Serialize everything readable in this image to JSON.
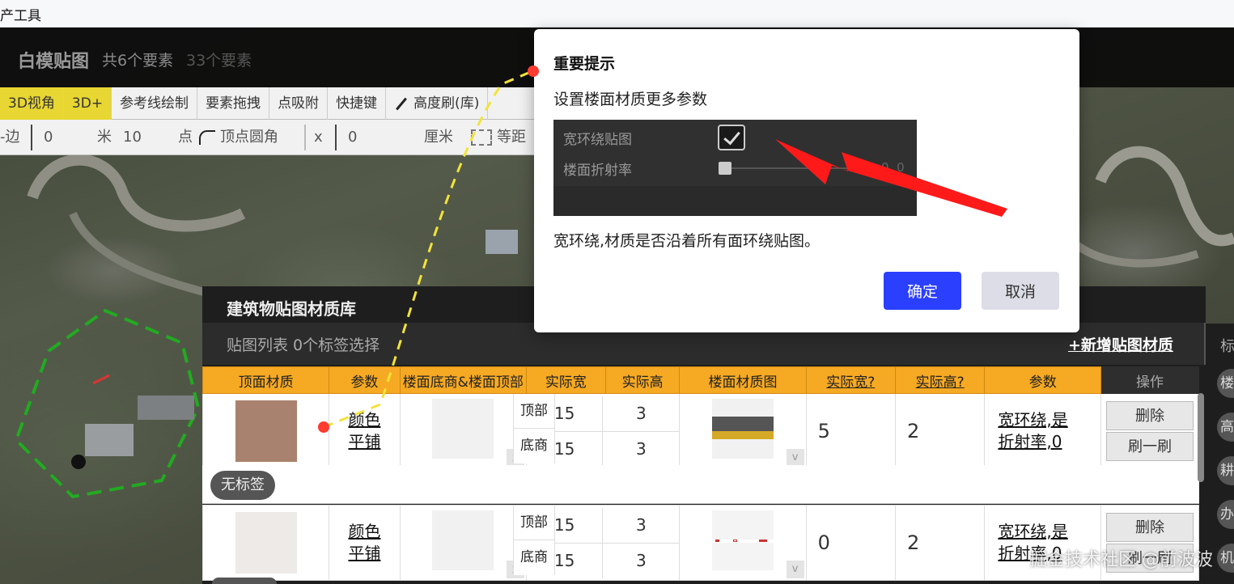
{
  "window": {
    "title": "产工具"
  },
  "app": {
    "title": "白模贴图",
    "element_count": "共6个要素",
    "element_count_alt": "33个要素"
  },
  "toolbar": {
    "buttons": [
      "3D视角",
      "3D+",
      "参考线绘制",
      "要素拖拽",
      "点吸附",
      "快捷键",
      "高度刷(库)"
    ],
    "row2": {
      "edge_label": "-边",
      "field1": "0",
      "unit_m": "米",
      "field2": "10",
      "point_label": "点",
      "corner_label": "顶点圆角",
      "x_label": "x",
      "field3": "0",
      "unit_cm": "厘米",
      "equidist_label": "等距"
    }
  },
  "library": {
    "title": "建筑物贴图材质库",
    "list_label": "贴图列表 0个标签选择",
    "add_button": "+新增贴图材质",
    "right_title": "标",
    "right_chips": [
      "楼",
      "高",
      "耕",
      "办",
      "机"
    ],
    "headers": [
      "顶面材质",
      "参数",
      "楼面底商&楼面顶部",
      "实际宽",
      "实际高",
      "楼面材质图",
      "实际宽?",
      "实际高?",
      "参数",
      "操作"
    ],
    "rows": [
      {
        "swatch_color": "#a8826e",
        "param": [
          "颜色",
          "平铺"
        ],
        "top_label": "顶部",
        "top_w": "15",
        "top_h": "3",
        "bottom_label": "底商",
        "bottom_w": "15",
        "bottom_h": "3",
        "real_w": "5",
        "real_h": "2",
        "param2": [
          "宽环绕,是",
          "折射率,0"
        ],
        "delete": "删除",
        "brush": "刷一刷",
        "tag": "无标签"
      },
      {
        "swatch_color": "#eeeae8",
        "param": [
          "颜色",
          "平铺"
        ],
        "top_label": "顶部",
        "top_w": "15",
        "top_h": "3",
        "bottom_label": "底商",
        "bottom_w": "15",
        "bottom_h": "3",
        "real_w": "0",
        "real_h": "2",
        "param2": [
          "宽环绕,是",
          "折射率,0"
        ],
        "delete": "删除",
        "brush": "刷一刷"
      }
    ],
    "x_mark": "x",
    "v_mark": "v"
  },
  "modal": {
    "title": "重要提示",
    "subtitle": "设置楼面材质更多参数",
    "shot_row1": "宽环绕贴图",
    "shot_row2": "楼面折射率",
    "shot_value": "0. 0",
    "description": "宽环绕,材质是否沿着所有面环绕贴图。",
    "ok": "确定",
    "cancel": "取消"
  },
  "watermark": "掘金技术社区 @前波波",
  "colors": {
    "table_header": "#f6a922",
    "ok_button": "#2a3fff",
    "annotation_arrow": "#ff1a1a",
    "dash_line": "#f2e33a"
  }
}
